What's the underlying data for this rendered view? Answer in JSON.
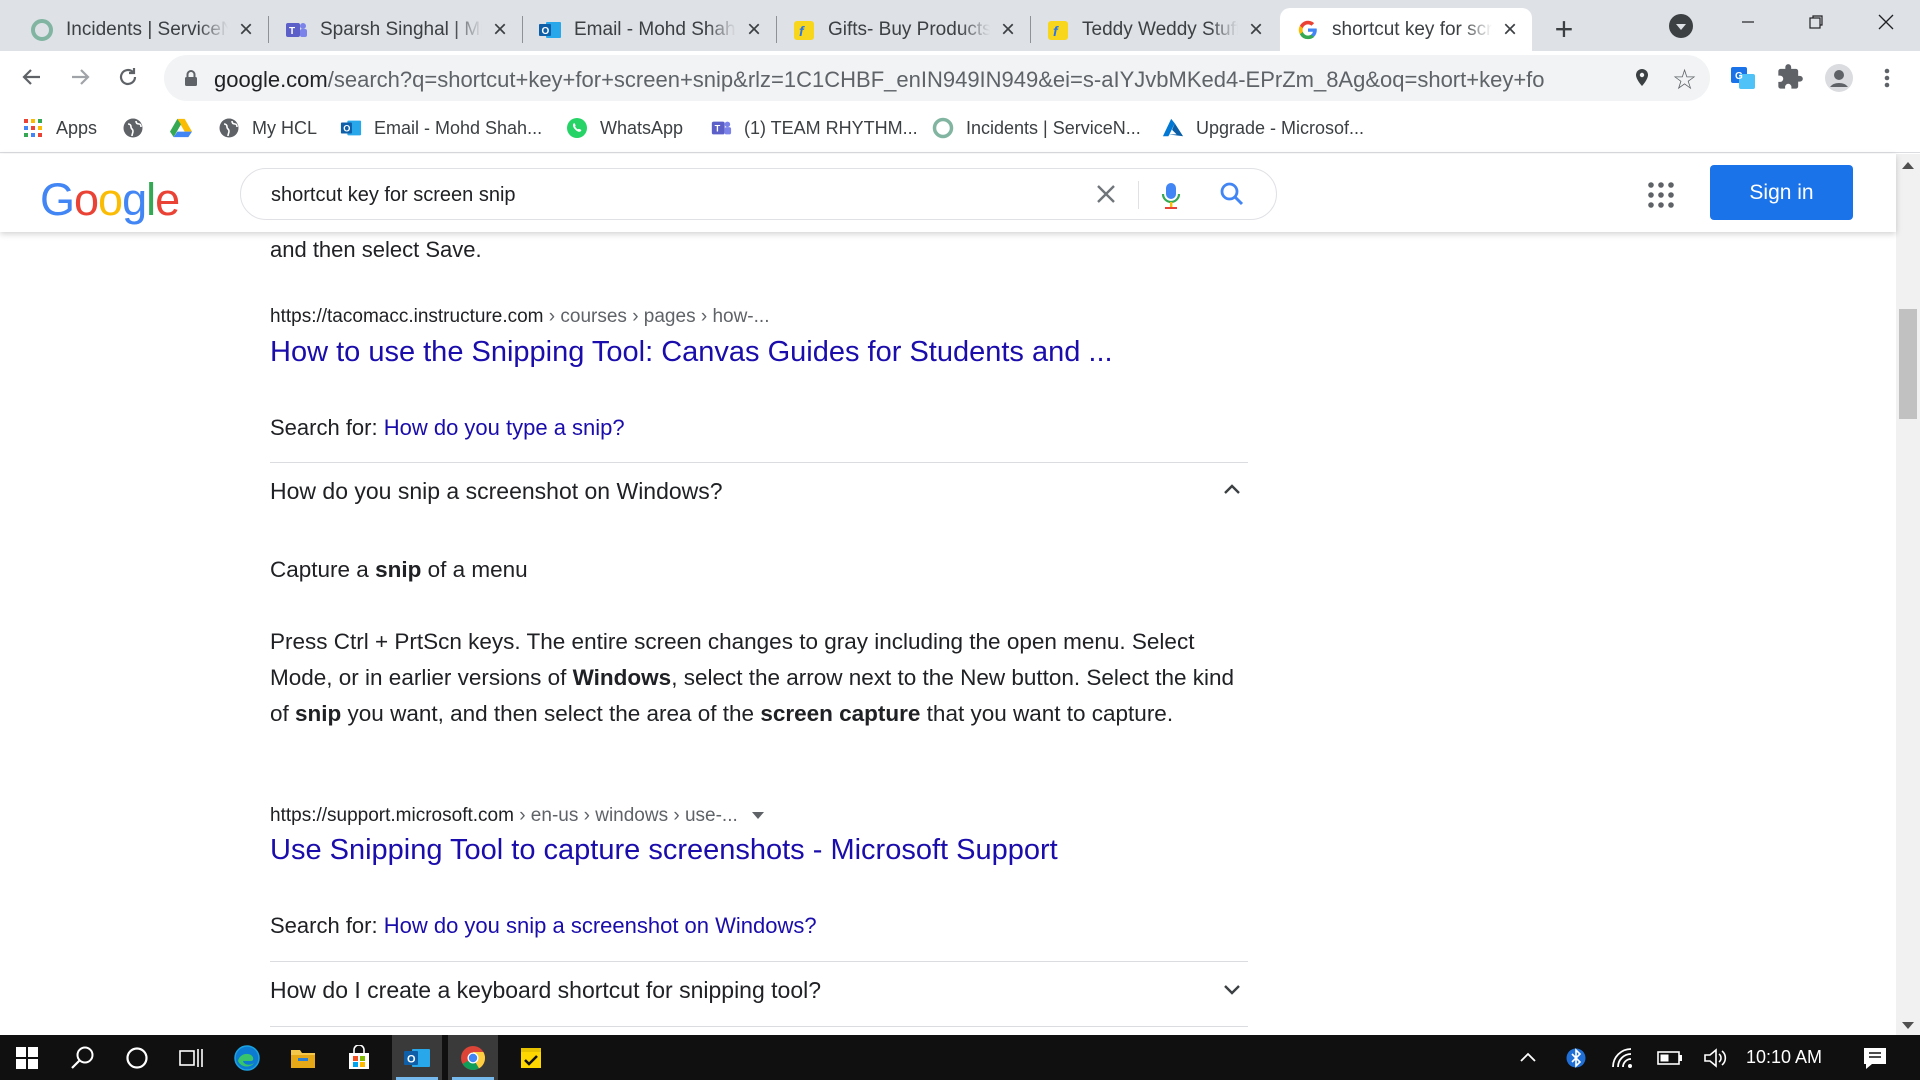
{
  "browser": {
    "tabs": [
      {
        "title": "Incidents | ServiceNow",
        "icon": "servicenow-icon",
        "active": false
      },
      {
        "title": "Sparsh Singhal | Microsoft Teams",
        "icon": "teams-icon",
        "active": false
      },
      {
        "title": "Email - Mohd Shahrukh",
        "icon": "outlook-icon",
        "active": false
      },
      {
        "title": "Gifts- Buy Products Online",
        "icon": "flipkart-icon",
        "active": false
      },
      {
        "title": "Teddy Weddy Stuffed",
        "icon": "flipkart-icon",
        "active": false
      },
      {
        "title": "shortcut key for screen snip",
        "icon": "google-icon",
        "active": true
      }
    ],
    "new_tab_label": "+",
    "url": {
      "host": "google.com",
      "rest": "/search?q=shortcut+key+for+screen+snip&rlz=1C1CHBF_enIN949IN949&ei=s-aIYJvbMKed4-EPrZm_8Ag&oq=short+key+for+&gs_lcp..."
    },
    "bookmarks": [
      {
        "label": "Apps",
        "icon": "apps-grid-icon"
      },
      {
        "label": "",
        "icon": "globe-icon"
      },
      {
        "label": "",
        "icon": "google-drive-icon"
      },
      {
        "label": "My HCL",
        "icon": "globe-icon"
      },
      {
        "label": "Email - Mohd Shah...",
        "icon": "outlook-icon"
      },
      {
        "label": "WhatsApp",
        "icon": "whatsapp-icon"
      },
      {
        "label": "(1) TEAM RHYTHM...",
        "icon": "teams-icon"
      },
      {
        "label": "Incidents | ServiceN...",
        "icon": "servicenow-icon"
      },
      {
        "label": "Upgrade - Microsof...",
        "icon": "azure-icon"
      }
    ]
  },
  "google": {
    "logo": [
      "G",
      "o",
      "o",
      "g",
      "l",
      "e"
    ],
    "query": "shortcut key for screen snip",
    "sign_in": "Sign in"
  },
  "results": {
    "top_text": "and then select Save.",
    "result1": {
      "cite_host": "https://tacomacc.instructure.com",
      "cite_path": " › courses › pages › how-...",
      "title": "How to use the Snipping Tool: Canvas Guides for Students and ..."
    },
    "search_for_1": {
      "label": "Search for: ",
      "query": "How do you type a snip?"
    },
    "question1": "How do you snip a screenshot on Windows?",
    "answer_heading": {
      "pre": "Capture a ",
      "bold": "snip",
      "post": " of a menu"
    },
    "answer_body": {
      "p1": "Press Ctrl + PrtScn keys. The entire screen changes to gray including the open menu. Select Mode, or in earlier versions of ",
      "b1": "Windows",
      "p2": ", select the arrow next to the New button. Select the kind of ",
      "b2": "snip",
      "p3": " you want, and then select the area of the ",
      "b3": "screen capture",
      "p4": " that you want to capture."
    },
    "result2": {
      "cite_host": "https://support.microsoft.com",
      "cite_path": " › en-us › windows › use-...",
      "title": "Use Snipping Tool to capture screenshots - Microsoft Support"
    },
    "search_for_2": {
      "label": "Search for: ",
      "query": "How do you snip a screenshot on Windows?"
    },
    "question2": "How do I create a keyboard shortcut for snipping tool?"
  },
  "taskbar": {
    "time": "10:10 AM"
  },
  "colors": {
    "link": "#1a0dab",
    "accent": "#1a73e8",
    "tabstrip": "#dee1e6",
    "taskbar": "#101010"
  }
}
